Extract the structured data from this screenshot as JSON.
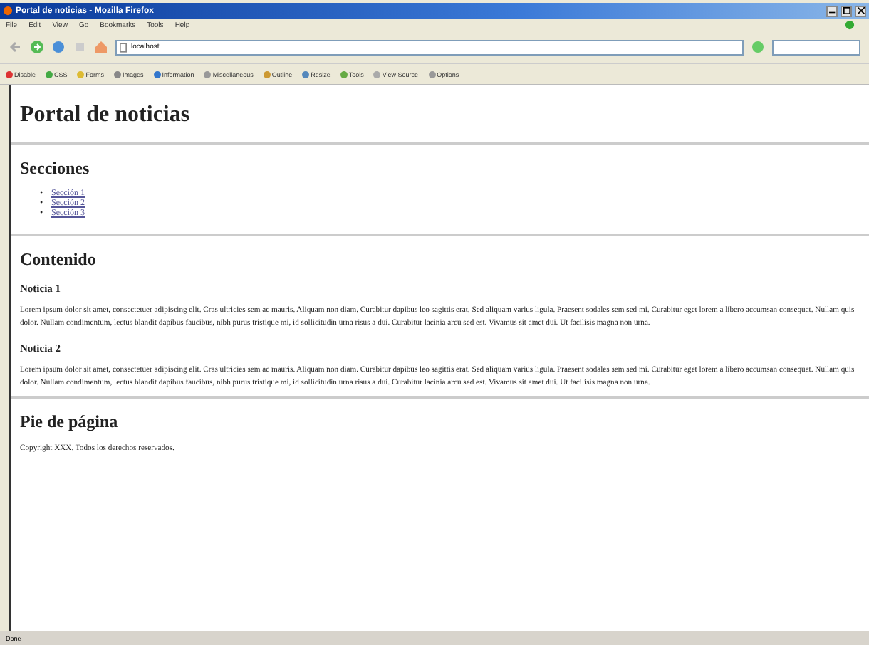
{
  "window": {
    "title": "Portal de noticias - Mozilla Firefox"
  },
  "menu": [
    "File",
    "Edit",
    "View",
    "Go",
    "Bookmarks",
    "Tools",
    "Help"
  ],
  "address": {
    "value": "localhost"
  },
  "dev_toolbar": [
    "Disable",
    "CSS",
    "Forms",
    "Images",
    "Information",
    "Miscellaneous",
    "Outline",
    "Resize",
    "Tools",
    "View Source",
    "Options"
  ],
  "page": {
    "title": "Portal de noticias",
    "sections_heading": "Secciones",
    "links": [
      {
        "marker": "•",
        "label": "Sección 1"
      },
      {
        "marker": "•",
        "label": "Sección 2"
      },
      {
        "marker": "•",
        "label": "Sección 3"
      }
    ],
    "content_heading": "Contenido",
    "news": [
      {
        "title": "Noticia 1",
        "body": "Lorem ipsum dolor sit amet, consectetuer adipiscing elit. Cras ultricies sem ac mauris. Aliquam non diam. Curabitur dapibus leo sagittis erat. Sed aliquam varius ligula. Praesent sodales sem sed mi. Curabitur eget lorem a libero accumsan consequat. Nullam quis dolor. Nullam condimentum, lectus blandit dapibus faucibus, nibh purus tristique mi, id sollicitudin urna risus a dui. Curabitur lacinia arcu sed est. Vivamus sit amet dui. Ut facilisis magna non urna."
      },
      {
        "title": "Noticia 2",
        "body": "Lorem ipsum dolor sit amet, consectetuer adipiscing elit. Cras ultricies sem ac mauris. Aliquam non diam. Curabitur dapibus leo sagittis erat. Sed aliquam varius ligula. Praesent sodales sem sed mi. Curabitur eget lorem a libero accumsan consequat. Nullam quis dolor. Nullam condimentum, lectus blandit dapibus faucibus, nibh purus tristique mi, id sollicitudin urna risus a dui. Curabitur lacinia arcu sed est. Vivamus sit amet dui. Ut facilisis magna non urna."
      }
    ],
    "footer_heading": "Pie de página",
    "copyright": "Copyright XXX. Todos los derechos reservados."
  },
  "status_bar": {
    "text": "Done"
  }
}
